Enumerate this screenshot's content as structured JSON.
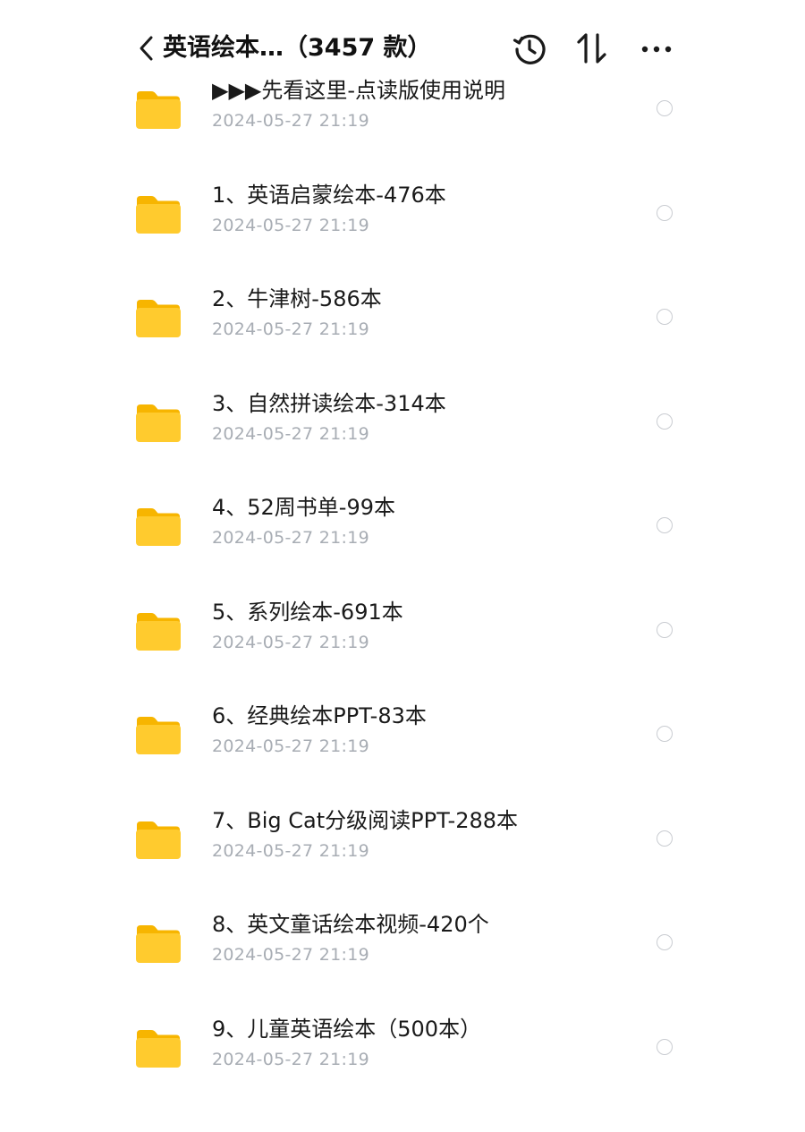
{
  "header": {
    "back_icon": "chevron-left-icon",
    "title": "英语绘本…（3457 款）",
    "actions": [
      {
        "name": "history",
        "icon": "history-icon"
      },
      {
        "name": "sort",
        "icon": "sort-icon"
      },
      {
        "name": "more",
        "icon": "more-icon"
      }
    ]
  },
  "theme": {
    "folder_color": "#FFCB2E",
    "folder_back_color": "#F7B500",
    "date_color": "#A8ADB4",
    "checkbox_border": "#C9CCD1"
  },
  "files": [
    {
      "name": "▶▶▶先看这里-点读版使用说明",
      "date": "2024-05-27 21:19",
      "selected": false
    },
    {
      "name": "1、英语启蒙绘本-476本",
      "date": "2024-05-27 21:19",
      "selected": false
    },
    {
      "name": "2、牛津树-586本",
      "date": "2024-05-27 21:19",
      "selected": false
    },
    {
      "name": "3、自然拼读绘本-314本",
      "date": "2024-05-27 21:19",
      "selected": false
    },
    {
      "name": "4、52周书单-99本",
      "date": "2024-05-27 21:19",
      "selected": false
    },
    {
      "name": "5、系列绘本-691本",
      "date": "2024-05-27 21:19",
      "selected": false
    },
    {
      "name": "6、经典绘本PPT-83本",
      "date": "2024-05-27 21:19",
      "selected": false
    },
    {
      "name": "7、Big Cat分级阅读PPT-288本",
      "date": "2024-05-27 21:19",
      "selected": false
    },
    {
      "name": "8、英文童话绘本视频-420个",
      "date": "2024-05-27 21:19",
      "selected": false
    },
    {
      "name": "9、儿童英语绘本（500本）",
      "date": "2024-05-27 21:19",
      "selected": false
    }
  ]
}
